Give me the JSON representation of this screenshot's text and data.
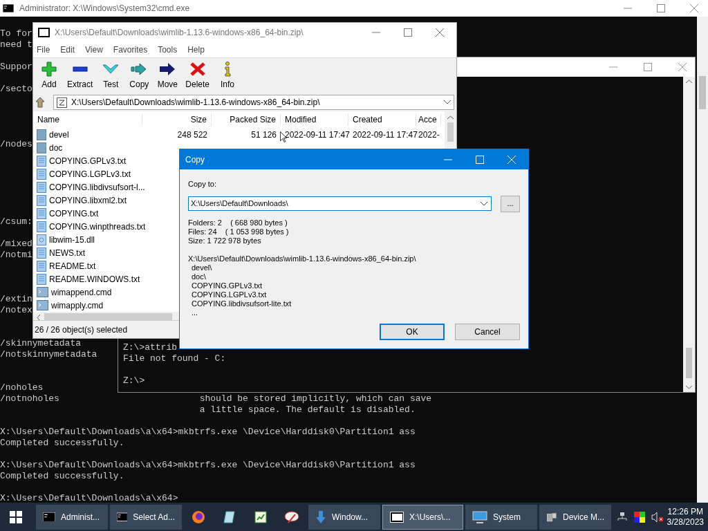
{
  "console": {
    "title": "Administrator: X:\\Windows\\System32\\cmd.exe",
    "blocks": [
      [
        "To for",
        "need t"
      ],
      [
        "Suppor"
      ],
      [
        "/secto"
      ],
      [
        "/nodes"
      ],
      [
        "/csum:"
      ],
      [
        "/mixed",
        "/notmi"
      ],
      [
        "/extin",
        "/notex"
      ],
      [
        "/skinnymetadata",
        "/notskinnymetadata"
      ],
      [
        "/noholes",
        "/notnoholes                          should be stored implicitly, which can save",
        "                                     a little space. The default is disabled."
      ],
      [
        "X:\\Users\\Default\\Downloads\\a\\x64>mkbtrfs.exe \\Device\\Harddisk0\\Partition1 ass",
        "Completed successfully."
      ],
      [
        "X:\\Users\\Default\\Downloads\\a\\x64>mkbtrfs.exe \\Device\\Harddisk0\\Partition1 ass",
        "Completed successfully."
      ],
      [
        "X:\\Users\\Default\\Downloads\\a\\x64>"
      ]
    ]
  },
  "console2": {
    "blocks": [
      [
        "Z:\\>attrib",
        "File not found - C:"
      ],
      [
        "Z:\\>"
      ]
    ]
  },
  "archive": {
    "title": "X:\\Users\\Default\\Downloads\\wimlib-1.13.6-windows-x86_64-bin.zip\\",
    "menu": [
      "File",
      "Edit",
      "View",
      "Favorites",
      "Tools",
      "Help"
    ],
    "toolbar": [
      {
        "kind": "add",
        "label": "Add"
      },
      {
        "kind": "extract",
        "label": "Extract"
      },
      {
        "kind": "test",
        "label": "Test"
      },
      {
        "kind": "copy",
        "label": "Copy"
      },
      {
        "kind": "move",
        "label": "Move"
      },
      {
        "kind": "delete",
        "label": "Delete"
      },
      {
        "kind": "info",
        "label": "Info"
      }
    ],
    "address": "X:\\Users\\Default\\Downloads\\wimlib-1.13.6-windows-x86_64-bin.zip\\",
    "columns": [
      "Name",
      "Size",
      "Packed Size",
      "Modified",
      "Created",
      "Acce"
    ],
    "rows": [
      {
        "kind": "folder",
        "cells": [
          "devel",
          "248 522",
          "51 126",
          "2022-09-11 17:47",
          "2022-09-11 17:47",
          "2022-"
        ]
      },
      {
        "kind": "folder",
        "cells": [
          "doc"
        ]
      },
      {
        "kind": "text",
        "cells": [
          "COPYING.GPLv3.txt"
        ]
      },
      {
        "kind": "text",
        "cells": [
          "COPYING.LGPLv3.txt"
        ]
      },
      {
        "kind": "text",
        "cells": [
          "COPYING.libdivsufsort-l..."
        ]
      },
      {
        "kind": "text",
        "cells": [
          "COPYING.libxml2.txt"
        ]
      },
      {
        "kind": "text",
        "cells": [
          "COPYING.txt"
        ]
      },
      {
        "kind": "text",
        "cells": [
          "COPYING.winpthreads.txt"
        ]
      },
      {
        "kind": "library",
        "cells": [
          "libwim-15.dll"
        ]
      },
      {
        "kind": "text",
        "cells": [
          "NEWS.txt"
        ]
      },
      {
        "kind": "text",
        "cells": [
          "README.txt"
        ]
      },
      {
        "kind": "text",
        "cells": [
          "README.WINDOWS.txt"
        ]
      },
      {
        "kind": "script",
        "cells": [
          "wimappend.cmd"
        ]
      },
      {
        "kind": "script",
        "cells": [
          "wimapply.cmd"
        ]
      }
    ],
    "status": "26 / 26 object(s) selected"
  },
  "dialog": {
    "title": "Copy",
    "label": "Copy to:",
    "destination": "X:\\Users\\Default\\Downloads\\",
    "browse": "...",
    "summary": [
      "Folders: 2    ( 668 980 bytes )",
      "Files: 24    ( 1 053 998 bytes )",
      "Size: 1 722 978 bytes"
    ],
    "listing": {
      "path": "X:\\Users\\Default\\Downloads\\wimlib-1.13.6-windows-x86_64-bin.zip\\",
      "items": [
        "devel\\",
        "doc\\",
        "COPYING.GPLv3.txt",
        "COPYING.LGPLv3.txt",
        "COPYING.libdivsufsort-lite.txt",
        "..."
      ]
    },
    "buttons": [
      {
        "label": "OK",
        "default": true
      },
      {
        "label": "Cancel",
        "default": false
      }
    ]
  },
  "taskbar": {
    "items": [
      {
        "kind": "console",
        "label": "Administ...",
        "selected": false
      },
      {
        "kind": "console",
        "label": "Select Ad...",
        "selected": false
      },
      {
        "kind": "browser",
        "selected": false
      },
      {
        "kind": "notepad",
        "selected": false
      },
      {
        "kind": "spreadsheet",
        "selected": false
      },
      {
        "kind": "paint",
        "selected": false
      },
      {
        "kind": "download",
        "label": "Window...",
        "selected": false
      },
      {
        "kind": "archive",
        "label": "X:\\Users\\...",
        "selected": true
      },
      {
        "kind": "monitor",
        "label": "System",
        "selected": false
      },
      {
        "kind": "device",
        "label": "Device M...",
        "selected": false
      }
    ],
    "time": "12:26 PM",
    "date": "3/28/2023"
  }
}
